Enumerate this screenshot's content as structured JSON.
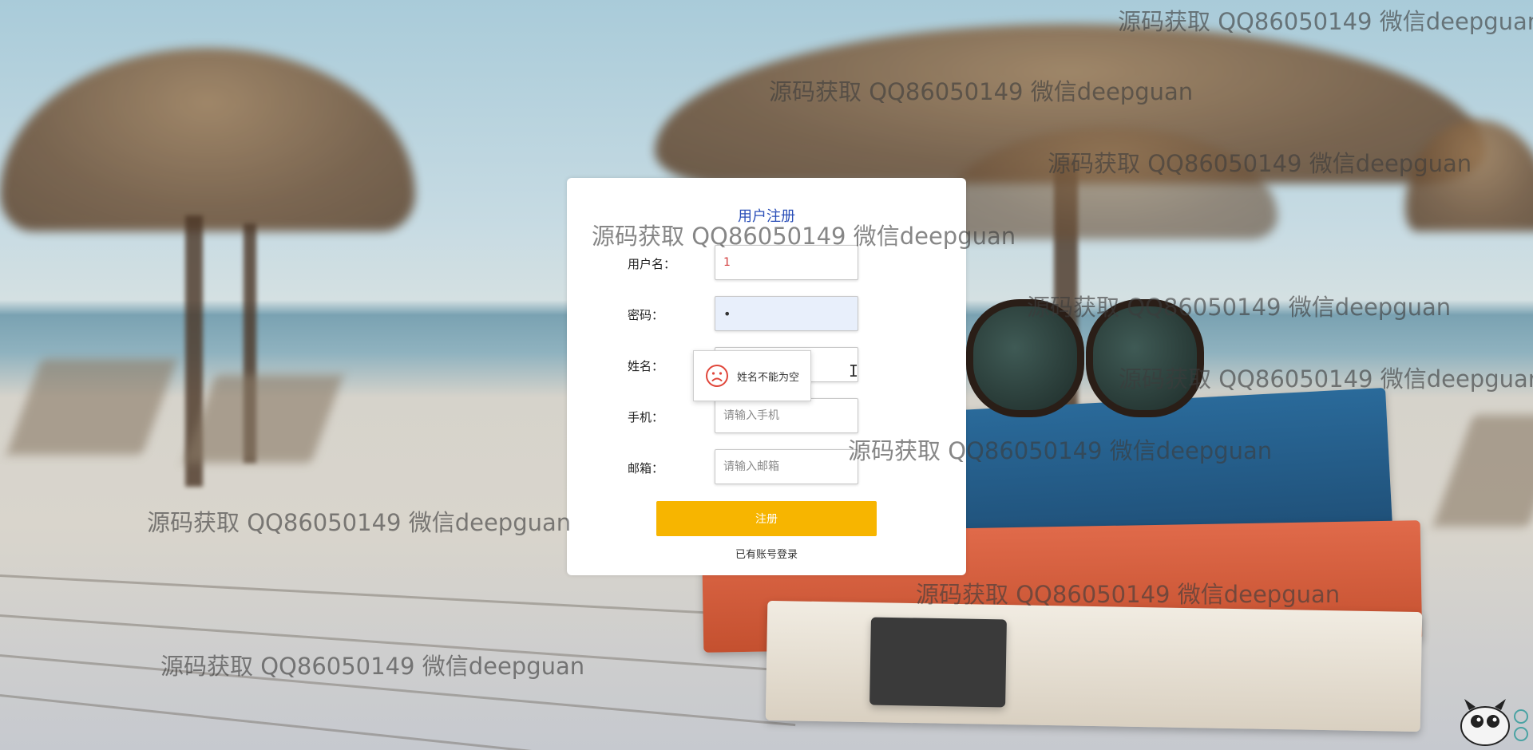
{
  "page": {
    "title": "用户注册"
  },
  "form": {
    "username": {
      "label": "用户名：",
      "value": "1",
      "placeholder": ""
    },
    "password": {
      "label": "密码：",
      "value": "1",
      "placeholder": ""
    },
    "name": {
      "label": "姓名：",
      "value": "",
      "placeholder": ""
    },
    "phone": {
      "label": "手机：",
      "value": "",
      "placeholder": "请输入手机"
    },
    "email": {
      "label": "邮箱：",
      "value": "",
      "placeholder": "请输入邮箱"
    },
    "submit_label": "注册",
    "login_link": "已有账号登录"
  },
  "tooltip": {
    "message": "姓名不能为空",
    "icon": "sad-face-icon"
  },
  "watermark_text": "源码获取 QQ86050149 微信deepguan",
  "colors": {
    "title": "#2b4fb8",
    "submit": "#f7b500",
    "tooltip_icon": "#e0463a"
  }
}
